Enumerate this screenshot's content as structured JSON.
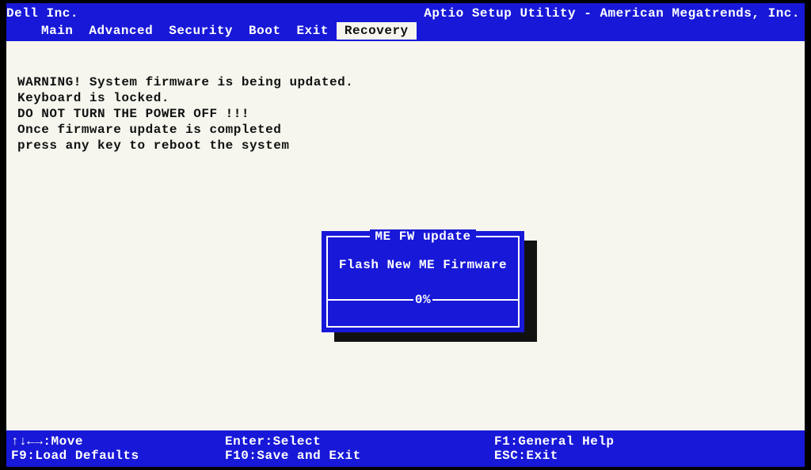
{
  "colors": {
    "bios_blue": "#1818d8",
    "panel_bg": "#f6f6ef"
  },
  "header": {
    "vendor": "Dell Inc.",
    "utility_title": "Aptio Setup Utility - American Megatrends, Inc."
  },
  "tabs": {
    "items": [
      "Main",
      "Advanced",
      "Security",
      "Boot",
      "Exit",
      "Recovery"
    ],
    "active_index": 5
  },
  "warning_lines": [
    "WARNING! System firmware is being updated.",
    "Keyboard is locked.",
    "DO NOT TURN THE POWER OFF !!!",
    "Once firmware update is completed",
    "press any key to reboot the system"
  ],
  "dialog": {
    "title": "ME FW update",
    "message": "Flash New ME Firmware",
    "progress_text": "0%",
    "progress_value": 0
  },
  "footer": {
    "row1": {
      "col1": "↑↓←→:Move",
      "col2": "Enter:Select",
      "col3": "F1:General Help"
    },
    "row2": {
      "col1": "F9:Load Defaults",
      "col2": "F10:Save and Exit",
      "col3": "ESC:Exit"
    }
  }
}
